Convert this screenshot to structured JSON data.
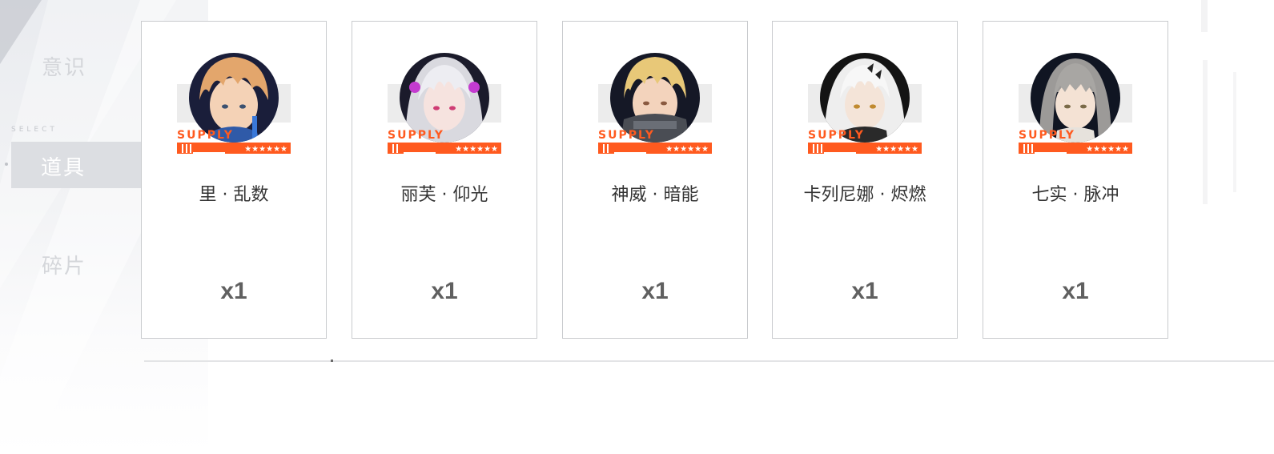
{
  "side_menu": {
    "select_caption": "SELECT",
    "items": [
      {
        "label": "意识"
      },
      {
        "label": "道具"
      },
      {
        "label": "碎片"
      }
    ]
  },
  "colors": {
    "accent": "#ff5a1f",
    "card_border": "#c9cbce",
    "name_text": "#333333",
    "qty_text": "#606060"
  },
  "cards": [
    {
      "name": "里 · 乱数",
      "quantity": "x1",
      "badge": "SUPPLY",
      "stars": "★★★★★★",
      "icon": "character-portrait-icon"
    },
    {
      "name": "丽芙 · 仰光",
      "quantity": "x1",
      "badge": "SUPPLY",
      "stars": "★★★★★★",
      "icon": "character-portrait-icon"
    },
    {
      "name": "神威 · 暗能",
      "quantity": "x1",
      "badge": "SUPPLY",
      "stars": "★★★★★★",
      "icon": "character-portrait-icon"
    },
    {
      "name": "卡列尼娜 · 烬燃",
      "quantity": "x1",
      "badge": "SUPPLY",
      "stars": "★★★★★★",
      "icon": "character-portrait-icon"
    },
    {
      "name": "七实 · 脉冲",
      "quantity": "x1",
      "badge": "SUPPLY",
      "stars": "★★★★★★",
      "icon": "character-portrait-icon"
    }
  ]
}
